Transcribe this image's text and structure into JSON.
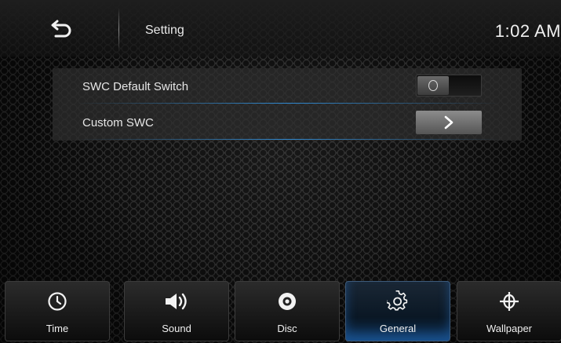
{
  "header": {
    "title": "Setting",
    "clock": "1:02  AM",
    "back_icon": "back-arrow-icon"
  },
  "settings": [
    {
      "label": "SWC Default Switch",
      "control": "toggle",
      "state": "off"
    },
    {
      "label": "Custom SWC",
      "control": "chevron-button"
    }
  ],
  "tabs": [
    {
      "label": "Time",
      "icon": "clock-icon",
      "active": false
    },
    {
      "label": "Sound",
      "icon": "speaker-icon",
      "active": false
    },
    {
      "label": "Disc",
      "icon": "disc-icon",
      "active": false
    },
    {
      "label": "General",
      "icon": "gear-icon",
      "active": true
    },
    {
      "label": "Wallpaper",
      "icon": "wallpaper-icon",
      "active": false
    }
  ],
  "colors": {
    "accent": "#2a7fd0",
    "text": "#e8e8e8"
  }
}
